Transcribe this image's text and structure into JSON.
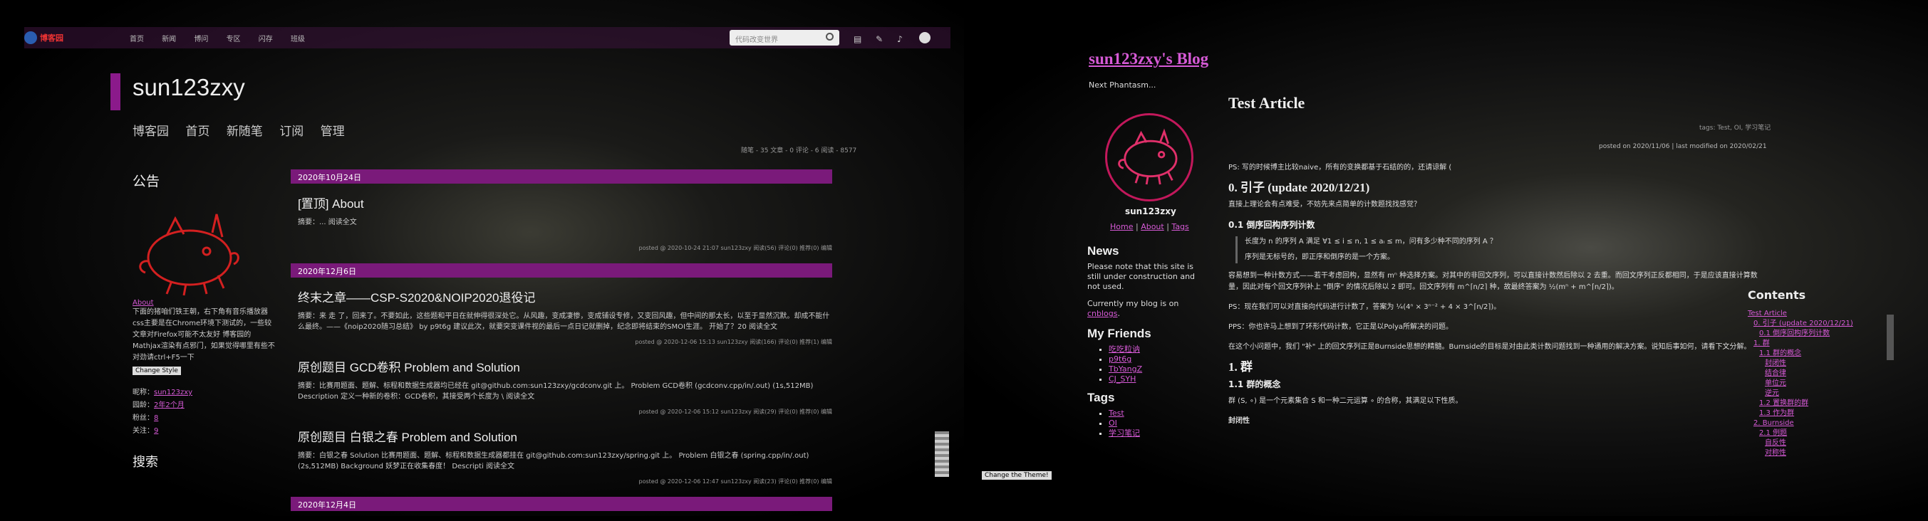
{
  "left": {
    "brand": "博客园",
    "topnav": [
      "首页",
      "新闻",
      "博问",
      "专区",
      "闪存",
      "班级"
    ],
    "search_placeholder": "代码改变世界",
    "blog_title": "sun123zxy",
    "blog_nav": [
      "博客园",
      "首页",
      "新随笔",
      "订阅",
      "管理"
    ],
    "stats": "随笔 - 35  文章 - 0  评论 - 6  阅读 - 8577",
    "notice_title": "公告",
    "about_link": "About",
    "about_text": "下面的猪咱们铁王朝，右下角有音乐播放器 css主要是在Chrome环境下测试的，一些较文章对Firefox可能不太友好 博客园的Mathjax渲染有点邪门，如果觉得哪里有些不对劲请ctrl+F5一下",
    "change_style": "Change Style",
    "info": [
      {
        "label": "昵称：",
        "value": "sun123zxy"
      },
      {
        "label": "园龄：",
        "value": "2年2个月"
      },
      {
        "label": "粉丝：",
        "value": "8"
      },
      {
        "label": "关注：",
        "value": "9"
      }
    ],
    "search_title": "搜索",
    "posts": [
      {
        "date": "2020年10月24日",
        "title": "[置顶] About",
        "summary": "摘要：... 阅读全文",
        "foot": "posted @ 2020-10-24 21:07 sun123zxy 阅读(56) 评论(0) 推荐(0) 编辑"
      },
      {
        "date": "2020年12月6日",
        "title": "终末之章——CSP-S2020&NOIP2020退役记",
        "summary": "摘要：来 走 了，回来了。不要如此，这些题和平日在就伸得很深处它。从风趣，变成凄惨，变成铺设专修，又变回风趣，但中间的那太长，以至于显然沉默。却成不能什么最终。——《noip2020随习总结》 by p9t6g 建议此次，就要突变课件视的最后一点日记就删掉，纪念即将结束的SMOI生涯。 开始了？20 阅读全文",
        "foot": "posted @ 2020-12-06 15:13 sun123zxy 阅读(166) 评论(0) 推荐(1) 编辑"
      },
      {
        "date": "",
        "title": "原创题目 GCD卷积 Problem and Solution",
        "summary": "摘要：比赛用题面、题解、标程和数据生成器均已经在 git@github.com:sun123zxy/gcdconv.git 上。 Problem GCD卷积 (gcdconv.cpp/in/.out) (1s,512MB) Description 定义一种新的卷积：GCD卷积，其接受两个长度为 \\ 阅读全文",
        "foot": "posted @ 2020-12-06 15:12 sun123zxy 阅读(29) 评论(0) 推荐(0) 编辑"
      },
      {
        "date": "",
        "title": "原创题目 白银之春 Problem and Solution",
        "summary": "摘要：白银之春 Solution 比赛用题面、题解、标程和数据生成器都挂在 git@github.com:sun123zxy/spring.git 上。 Problem 白银之春 (spring.cpp/in/.out) (2s,512MB) Background 妖梦正在收集春度！ Descripti 阅读全文",
        "foot": "posted @ 2020-12-06 12:47 sun123zxy 阅读(23) 评论(0) 推荐(0) 编辑"
      },
      {
        "date": "2020年12月4日",
        "title": "",
        "summary": "",
        "foot": ""
      }
    ]
  },
  "right": {
    "blog_title": "sun123zxy's Blog",
    "subtitle": "Next Phantasm...",
    "user": "sun123zxy",
    "links": [
      "Home",
      "About",
      "Tags"
    ],
    "news_title": "News",
    "news_text": "Please note that this site is still under construction and not used.",
    "news_text2": "Currently my blog is on",
    "news_link": "cnblogs",
    "friends_title": "My Friends",
    "friends": [
      "吃吃粒讷",
      "p9t6g",
      "TbYangZ",
      "CJ_SYH"
    ],
    "tags_title": "Tags",
    "tags": [
      "Test",
      "OI",
      "学习笔记"
    ],
    "article": {
      "title": "Test Article",
      "tags_line": "tags: Test, OI, 学习笔记",
      "posted": "posted on 2020/11/06 | last modified on 2020/02/21",
      "ps": "PS: 写的时候博主比较naive，所有的变换都基于石结的的，还请谅解 (",
      "h0": "0. 引子 (update 2020/12/21)",
      "p0": "直接上理论会有点难受，不妨先来点简单的计数题找找感觉？",
      "h01": "0.1 倒序回构序列计数",
      "q1": "长度为 n 的序列 A 满足 ∀1 ≤ i ≤ n, 1 ≤ aᵢ ≤ m，问有多少种不同的序列 A ？",
      "q2": "序列是无标号的，即正序和倒序的是一个方案。",
      "p1": "容易想到一种计数方式——若干考虑回构，显然有 mⁿ 种选择方案。对其中的非回文序列，可以直接计数然后除以 2 去重。而回文序列正反都相同，于是应该直接计算数量，因此对每个回文序列补上 \"倒序\" 的情况后除以 2 即可。回文序列有 m^⌈n/2⌉ 种，故最终答案为 ½(mⁿ + m^⌈n/2⌉)。",
      "p2": "PS：现在我们可以对直接向代码进行计数了，答案为 ¼(4ⁿ × 3ⁿ⁻² + 4 × 3^⌈n/2⌉)。",
      "p3": "PPS：你也许马上想到了环形代码计数，它正是以Polya所解决的问题。",
      "p4": "在这个小问题中，我们 \"补\" 上的回文序列正是Burnside思想的精髓。Burnside的目标是对由此类计数问题找到一种通用的解决方案。说知后事如何，请看下文分解。",
      "h1": "1. 群",
      "h11": "1.1 群的概念",
      "p5": "群 (S, ∘) 是一个元素集合 S 和一种二元运算 ∘ 的合称，其满足以下性质。",
      "p6": "封闭性"
    },
    "toc_title": "Contents",
    "toc": [
      "Test Article",
      "0. 引子 (update 2020/12/21)",
      "0.1 倒序回构序列计数",
      "1. 群",
      "1.1 群的概念",
      "封闭性",
      "结合律",
      "单位元",
      "逆元",
      "1.2 置换群的群",
      "1.3 作为群",
      "2. Burnside",
      "2.1 例题",
      "自反性",
      "对称性"
    ],
    "theme_button": "Change the Theme!"
  }
}
